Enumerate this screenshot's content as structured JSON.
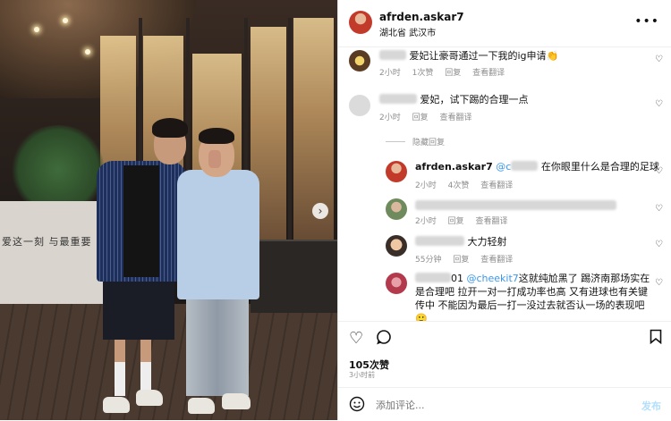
{
  "photo": {
    "wall_text": "爱这一刻  与最重要",
    "next_icon": "chevron-right-icon",
    "slide_count": 5,
    "active_slide": 1
  },
  "header": {
    "username": "afrden.askar7",
    "location": "湖北省 武汉市",
    "more_icon": "more-horizontal-icon"
  },
  "comments": [
    {
      "text": "爱妃让豪哥通过一下我的ig申请👏",
      "time": "2小时",
      "likes": "1次赞",
      "reply": "回复",
      "translate": "查看翻译"
    },
    {
      "text": "爱妃，试下踢的合理一点",
      "time": "2小时",
      "reply": "回复",
      "translate": "查看翻译"
    }
  ],
  "hide_replies": "隐藏回复",
  "replies": [
    {
      "username": "afrden.askar7",
      "mention": "@c",
      "text": "在你眼里什么是合理的足球",
      "time": "2小时",
      "likes": "4次赞",
      "translate": "查看翻译"
    },
    {
      "time": "2小时",
      "reply": "回复",
      "translate": "查看翻译"
    },
    {
      "text": "大力轻射",
      "time": "55分钟",
      "reply": "回复",
      "translate": "查看翻译"
    },
    {
      "prefix": "01",
      "mention": "@cheekit7",
      "text_line1": "这就纯尬黑了 踢济南那场实在",
      "text_line2": "是合理吧 拉开一对一打成功率也高 又有进球也有关键",
      "text_line3": "传中 不能因为最后一打一没过去就否认一场的表现吧",
      "emoji": "🙂"
    }
  ],
  "actions": {
    "like_icon": "heart-icon",
    "comment_icon": "comment-icon",
    "save_icon": "bookmark-icon"
  },
  "likes": "105次赞",
  "time_ago": "3小时前",
  "comment_box": {
    "placeholder": "添加评论...",
    "post_label": "发布",
    "emoji_icon": "emoji-icon"
  },
  "colors": {
    "link_blue": "#3897f0",
    "post_disabled": "#b2dffc",
    "meta_gray": "#8e8e8e"
  }
}
